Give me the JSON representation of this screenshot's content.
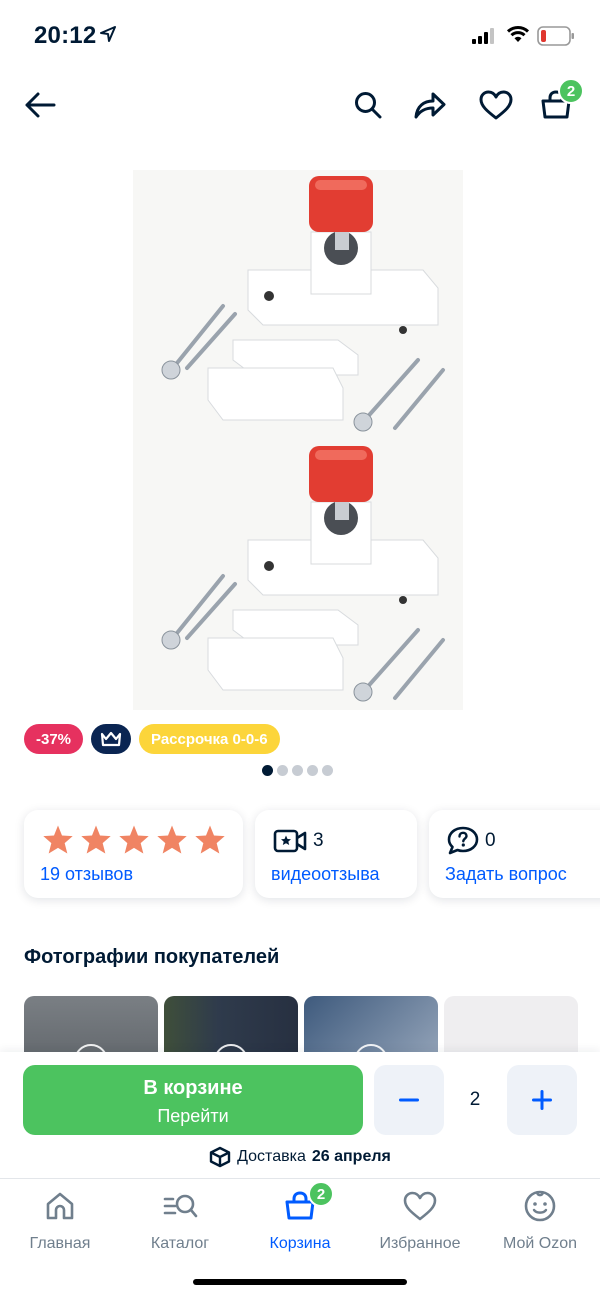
{
  "status_bar": {
    "time": "20:12"
  },
  "cart_badge_count": "2",
  "product": {
    "tags": {
      "discount": "-37%",
      "installment": "Рассрочка 0-0-6"
    },
    "image_count": 5,
    "active_image_index": 0
  },
  "rating": {
    "stars": 5,
    "reviews_label": "19 отзывов"
  },
  "video_reviews": {
    "count": "3",
    "label": "видеоотзыва"
  },
  "questions": {
    "count": "0",
    "label": "Задать вопрос"
  },
  "customer_photos_title": "Фотографии покупателей",
  "cart": {
    "button_title": "В корзине",
    "button_subtitle": "Перейти",
    "quantity": "2",
    "minus": "−",
    "plus": "+",
    "delivery_prefix": "Доставка",
    "delivery_date": "26 апреля"
  },
  "tabbar": {
    "items": [
      {
        "label": "Главная",
        "icon": "home-icon"
      },
      {
        "label": "Каталог",
        "icon": "catalog-icon"
      },
      {
        "label": "Корзина",
        "icon": "cart-icon",
        "badge": "2"
      },
      {
        "label": "Избранное",
        "icon": "heart-icon"
      },
      {
        "label": "Мой Ozon",
        "icon": "profile-icon"
      }
    ]
  },
  "colors": {
    "accent_blue": "#005bff",
    "cart_green": "#4cc35f",
    "discount_red": "#e6315f",
    "installment_yellow": "#fcd53a",
    "star_orange": "#f08463",
    "text_dark": "#001a34"
  }
}
